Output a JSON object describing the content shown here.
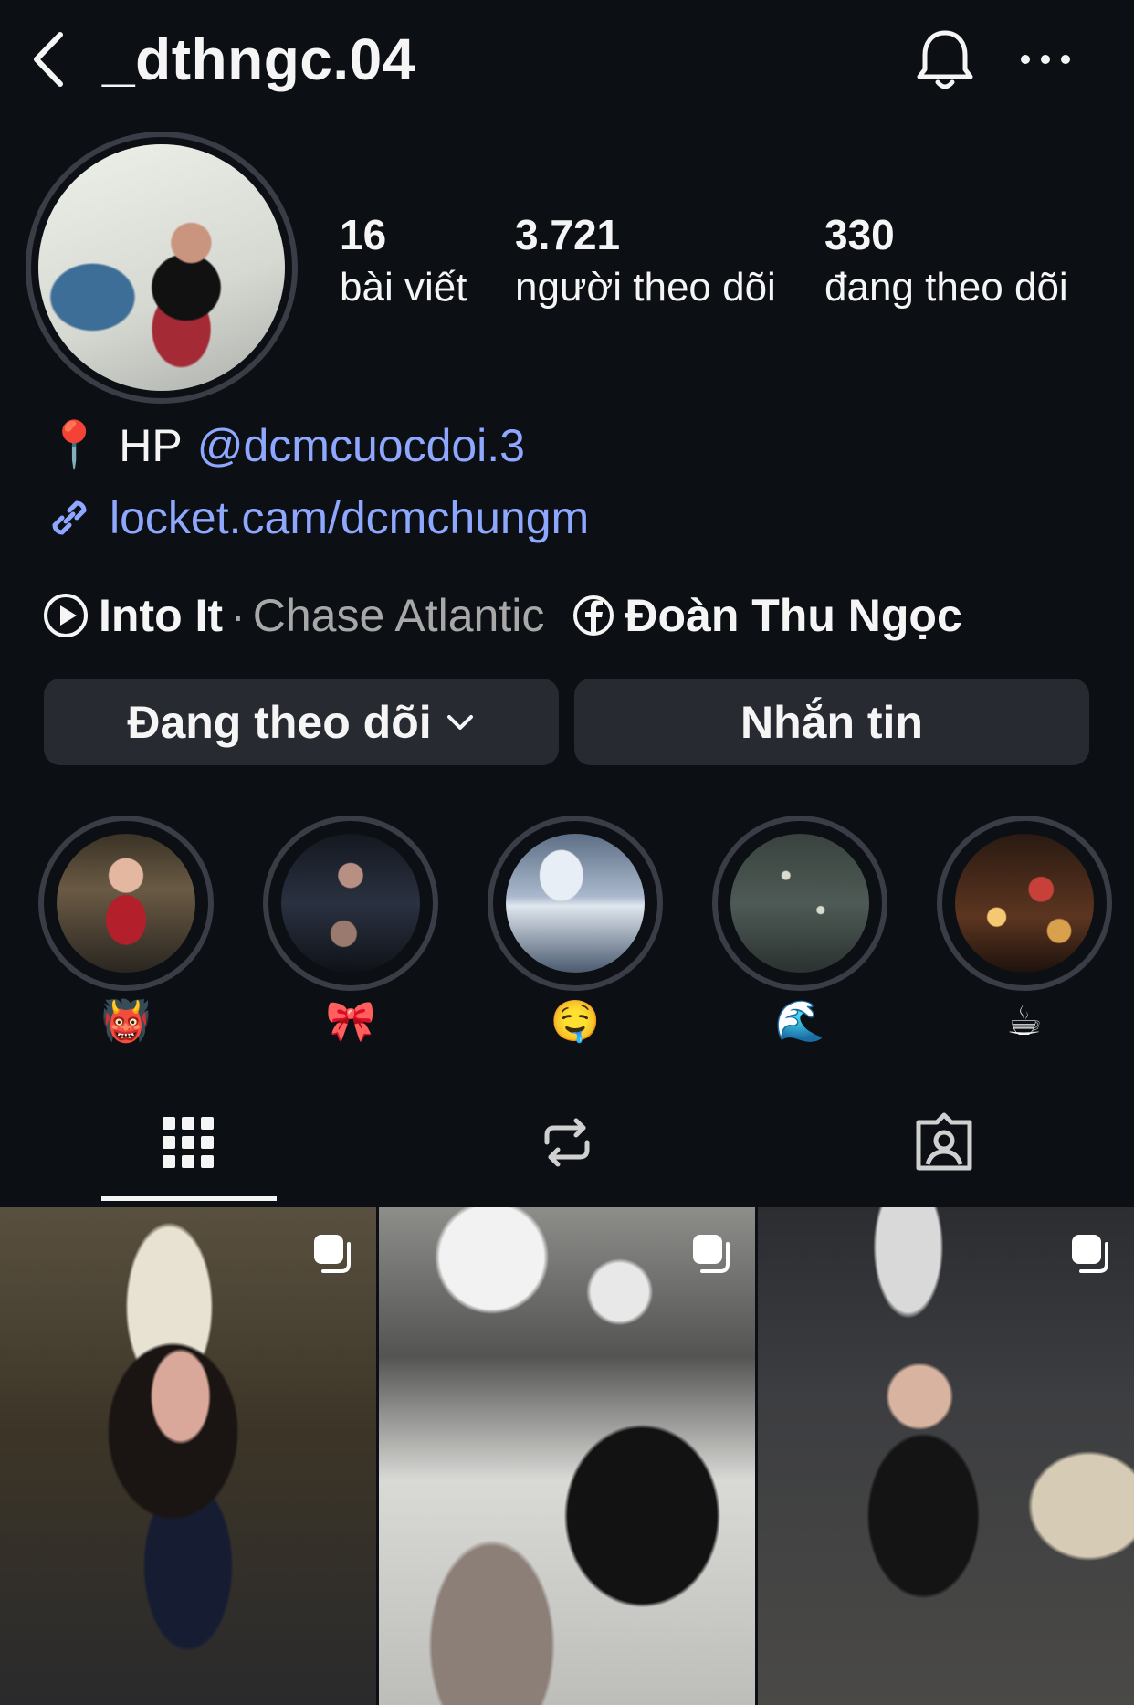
{
  "header": {
    "username": "_dthngc.04"
  },
  "stats": {
    "posts_count": "16",
    "posts_label": "bài viết",
    "followers_count": "3.721",
    "followers_label": "người theo dõi",
    "following_count": "330",
    "following_label": "đang theo dõi"
  },
  "bio": {
    "pin_emoji": "📍",
    "location": "HP",
    "mention": "@dcmcuocdoi.3",
    "link": "locket.cam/dcmchungm"
  },
  "meta": {
    "song": "Into It",
    "separator": "·",
    "artist": "Chase Atlantic",
    "facebook_name": "Đoàn Thu Ngọc"
  },
  "buttons": {
    "following": "Đang theo dõi",
    "message": "Nhắn tin"
  },
  "highlights": [
    {
      "label": "👹"
    },
    {
      "label": "🎀"
    },
    {
      "label": "🤤"
    },
    {
      "label": "🌊"
    },
    {
      "label": "☕"
    }
  ],
  "tabs": {
    "icons": [
      "grid-icon",
      "repost-icon",
      "tagged-icon"
    ],
    "active": "grid-icon"
  },
  "posts": [
    {
      "type": "carousel"
    },
    {
      "type": "carousel"
    },
    {
      "type": "carousel"
    }
  ],
  "colors": {
    "background": "#0c1014",
    "link": "#8fa8ff",
    "button": "#272b31",
    "secondary_text": "#a8a8a8"
  }
}
